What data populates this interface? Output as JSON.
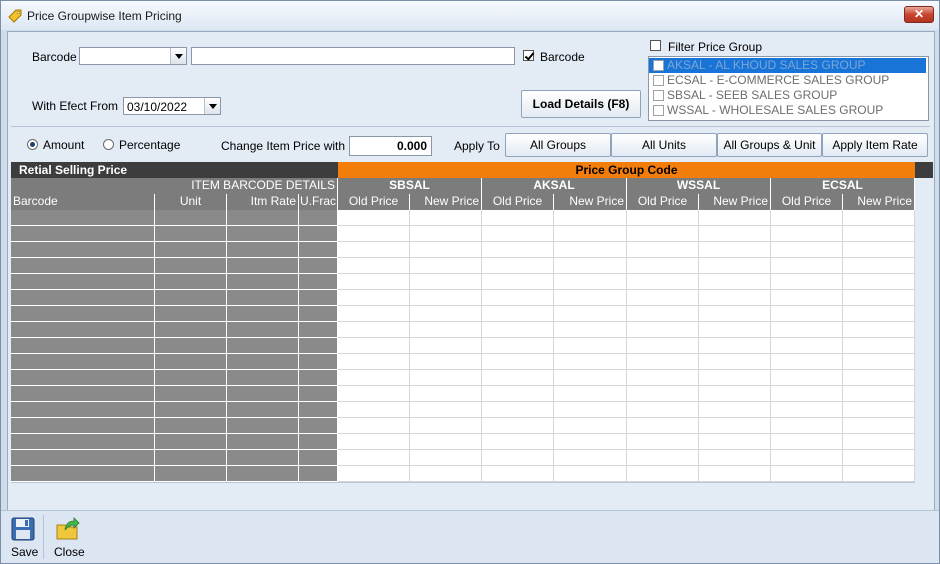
{
  "window": {
    "title": "Price Groupwise Item Pricing",
    "close_glyph": "✕"
  },
  "barcode_row": {
    "label": "Barcode",
    "combo_value": "",
    "text_value": "",
    "barcode_checkbox_label": "Barcode",
    "barcode_checked": true
  },
  "effect_row": {
    "label": "With Efect From",
    "date_value": "03/10/2022"
  },
  "load_button": "Load Details (F8)",
  "price_group_filter": {
    "label": "Filter Price Group",
    "checked": false,
    "items": [
      {
        "label": "AKSAL  - AL KHOUD SALES GROUP",
        "selected": true
      },
      {
        "label": "ECSAL  - E-COMMERCE SALES GROUP",
        "selected": false
      },
      {
        "label": "SBSAL  - SEEB SALES GROUP",
        "selected": false
      },
      {
        "label": "WSSAL  - WHOLESALE SALES GROUP",
        "selected": false
      }
    ]
  },
  "change_row": {
    "amount_label": "Amount",
    "percentage_label": "Percentage",
    "change_label": "Change Item Price with",
    "change_value": "0.000",
    "apply_to_label": "Apply To",
    "buttons": [
      "All Groups",
      "All Units",
      "All Groups & Unit",
      "Apply Item Rate"
    ]
  },
  "grid": {
    "band_left": "Retial Selling Price",
    "band_right": "Price Group Code",
    "item_details_header": "ITEM BARCODE DETAILS",
    "item_columns": [
      "Barcode",
      "Unit",
      "Itm Rate",
      "U.Frac"
    ],
    "groups": [
      "SBSAL",
      "AKSAL",
      "WSSAL",
      "ECSAL"
    ],
    "price_columns": [
      "Old Price",
      "New Price"
    ],
    "row_count": 17
  },
  "toolbar": {
    "save": "Save",
    "close": "Close"
  },
  "colors": {
    "band_dark": "#3d3d3d",
    "band_orange": "#f37d0a",
    "header_gray": "#7c7c7c",
    "selection_blue": "#1874d6"
  },
  "icons": {
    "app": "price-tag-icon",
    "save": "floppy-disk-icon",
    "close": "folder-exit-icon"
  }
}
